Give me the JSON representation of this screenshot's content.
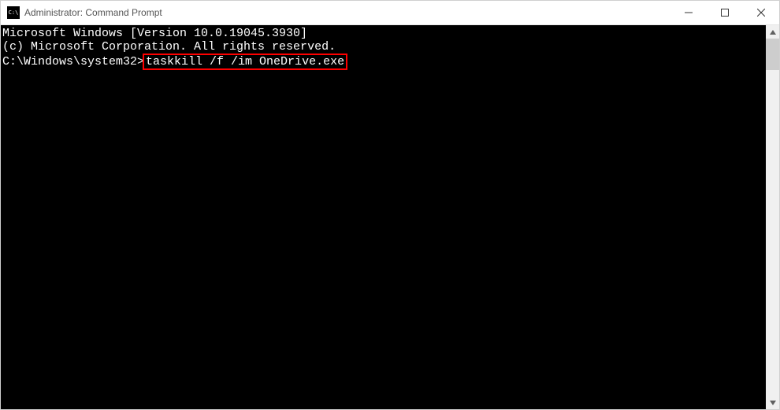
{
  "window": {
    "title": "Administrator: Command Prompt"
  },
  "terminal": {
    "line1": "Microsoft Windows [Version 10.0.19045.3930]",
    "line2": "(c) Microsoft Corporation. All rights reserved.",
    "blank": "",
    "prompt": "C:\\Windows\\system32>",
    "command": "taskkill /f /im OneDrive.exe"
  }
}
